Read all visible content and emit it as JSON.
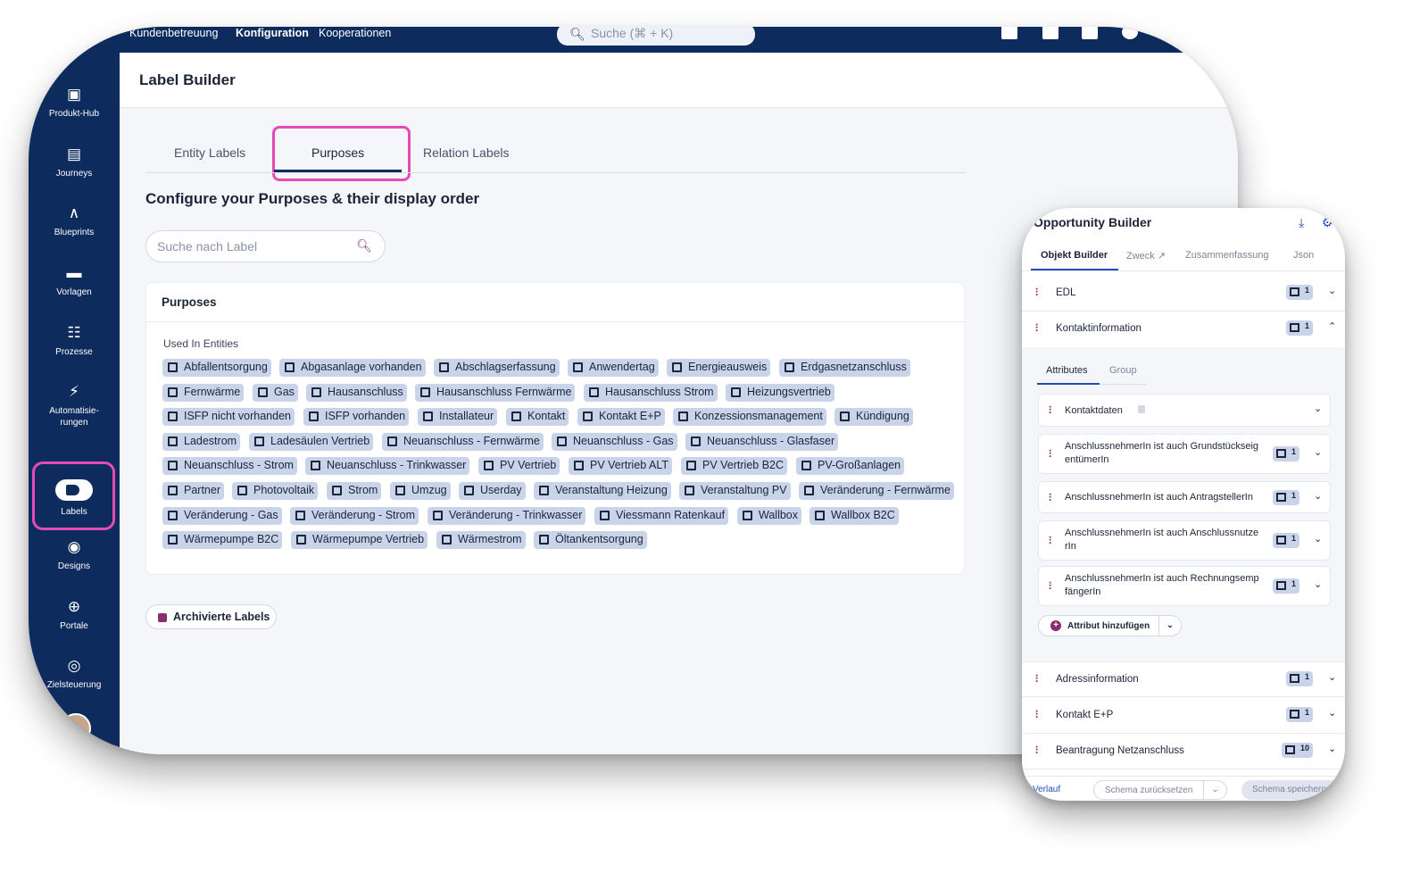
{
  "topbar": {
    "nav": [
      "Kundenbetreuung",
      "Konfiguration",
      "Kooperationen"
    ],
    "search_placeholder": "Suche (⌘ + K)"
  },
  "sidebar": {
    "items": [
      {
        "label": "Produkt-Hub",
        "icon": "box-icon"
      },
      {
        "label": "Journeys",
        "icon": "browser-icon"
      },
      {
        "label": "Blueprints",
        "icon": "compass-icon"
      },
      {
        "label": "Vorlagen",
        "icon": "folder-icon"
      },
      {
        "label": "Prozesse",
        "icon": "hierarchy-icon"
      },
      {
        "label": "Automatisie-",
        "label2": "rungen",
        "icon": "lightning-icon"
      },
      {
        "label": "Labels",
        "icon": "label-icon"
      },
      {
        "label": "Designs",
        "icon": "palette-icon"
      },
      {
        "label": "Portale",
        "icon": "globe-icon"
      },
      {
        "label": "Zielsteuerung",
        "icon": "target-icon"
      }
    ]
  },
  "page": {
    "title": "Label Builder",
    "tabs": [
      "Entity Labels",
      "Purposes",
      "Relation Labels"
    ],
    "active_tab": "Purposes",
    "heading": "Configure your Purposes & their display order",
    "search_placeholder": "Suche nach Label",
    "card_title": "Purposes",
    "used_in_label": "Used In Entities",
    "archive_button": "Archivierte Labels"
  },
  "chips": [
    [
      "Abfallentsorgung",
      "Abgasanlage vorhanden",
      "Abschlagserfassung",
      "Anwendertag",
      "Energieausweis",
      "Erdgasnetzanschluss"
    ],
    [
      "Fernwärme",
      "Gas",
      "Hausanschluss",
      "Hausanschluss Fernwärme",
      "Hausanschluss Strom",
      "Heizungsvertrieb"
    ],
    [
      "ISFP nicht vorhanden",
      "ISFP vorhanden",
      "Installateur",
      "Kontakt",
      "Kontakt E+P",
      "Konzessionsmanagement",
      "Kündigung"
    ],
    [
      "Ladestrom",
      "Ladesäulen Vertrieb",
      "Neuanschluss - Fernwärme",
      "Neuanschluss - Gas",
      "Neuanschluss - Glasfaser"
    ],
    [
      "Neuanschluss - Strom",
      "Neuanschluss - Trinkwasser",
      "PV Vertrieb",
      "PV Vertrieb ALT",
      "PV Vertrieb B2C",
      "PV-Großanlagen"
    ],
    [
      "Partner",
      "Photovoltaik",
      "Strom",
      "Umzug",
      "Userday",
      "Veranstaltung Heizung",
      "Veranstaltung PV",
      "Veränderung - Fernwärme"
    ],
    [
      "Veränderung - Gas",
      "Veränderung - Strom",
      "Veränderung - Trinkwasser",
      "Viessmann Ratenkauf",
      "Wallbox",
      "Wallbox B2C"
    ],
    [
      "Wärmepumpe B2C",
      "Wärmepumpe Vertrieb",
      "Wärmestrom",
      "Öltankentsorgung"
    ]
  ],
  "panel": {
    "title": "Opportunity Builder",
    "tabs": [
      "Objekt Builder",
      "Zweck",
      "Zusammenfassung",
      "Json"
    ],
    "rows_top": [
      {
        "label": "EDL",
        "count": "1"
      },
      {
        "label": "Kontaktinformation",
        "count": "1"
      }
    ],
    "attr_tabs": [
      "Attributes",
      "Group"
    ],
    "attributes": [
      {
        "label": "Kontaktdaten",
        "count": ""
      },
      {
        "label": "AnschlussnehmerIn ist auch Grundstückseig",
        "label2": "entümerIn",
        "count": "1"
      },
      {
        "label": "AnschlussnehmerIn ist auch AntragstellerIn",
        "count": "1"
      },
      {
        "label": "AnschlussnehmerIn ist auch Anschlussnutze",
        "label2": "rIn",
        "count": "1"
      },
      {
        "label": "AnschlussnehmerIn ist auch Rechnungsemp",
        "label2": "fängerIn",
        "count": "1"
      }
    ],
    "add_attribute": "Attribut hinzufügen",
    "rows_bottom": [
      {
        "label": "Adressinformation",
        "count": "1"
      },
      {
        "label": "Kontakt E+P",
        "count": "1"
      },
      {
        "label": "Beantragung Netzanschluss",
        "count": "10"
      }
    ],
    "footer": {
      "history": "Verlauf",
      "reset": "Schema zurücksetzen",
      "save": "Schema speichern"
    }
  },
  "colors": {
    "navy": "#0d2b5c",
    "highlight": "#e64bb5",
    "chip": "#c9d3ea",
    "accent": "#8c2d6f"
  }
}
